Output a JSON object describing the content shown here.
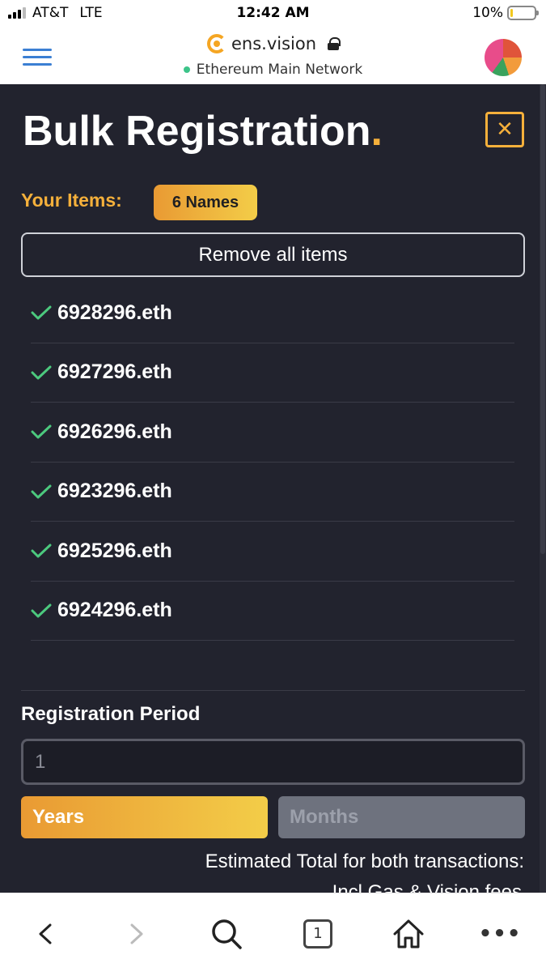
{
  "status_bar": {
    "carrier": "AT&T",
    "network_type": "LTE",
    "time": "12:42 AM",
    "battery_percent": "10%",
    "battery_level": 0.1
  },
  "header": {
    "site_name": "ens.vision",
    "network": "Ethereum Main Network"
  },
  "main": {
    "title": "Bulk Registration",
    "title_dot": ".",
    "items_label": "Your Items:",
    "names_badge": "6 Names",
    "remove_all_label": "Remove all items",
    "names": [
      "6928296.eth",
      "6927296.eth",
      "6926296.eth",
      "6923296.eth",
      "6925296.eth",
      "6924296.eth"
    ],
    "registration_period_label": "Registration Period",
    "period_value": "1",
    "years_label": "Years",
    "months_label": "Months",
    "estimated_total_label": "Estimated Total for both transactions:",
    "estimated_sub_label": "Incl Gas & Vision fees"
  },
  "toolbar": {
    "tab_count": "1"
  },
  "colors": {
    "accent": "#f5b03b",
    "panel_bg": "#22232e",
    "check_green": "#4cc97e",
    "link_blue": "#3b7fd3"
  },
  "icons": [
    "hamburger-icon",
    "ens-logo-icon",
    "lock-icon",
    "avatar",
    "close-icon",
    "check-icon",
    "back-icon",
    "forward-icon",
    "search-icon",
    "tabs-icon",
    "home-icon",
    "more-icon"
  ]
}
